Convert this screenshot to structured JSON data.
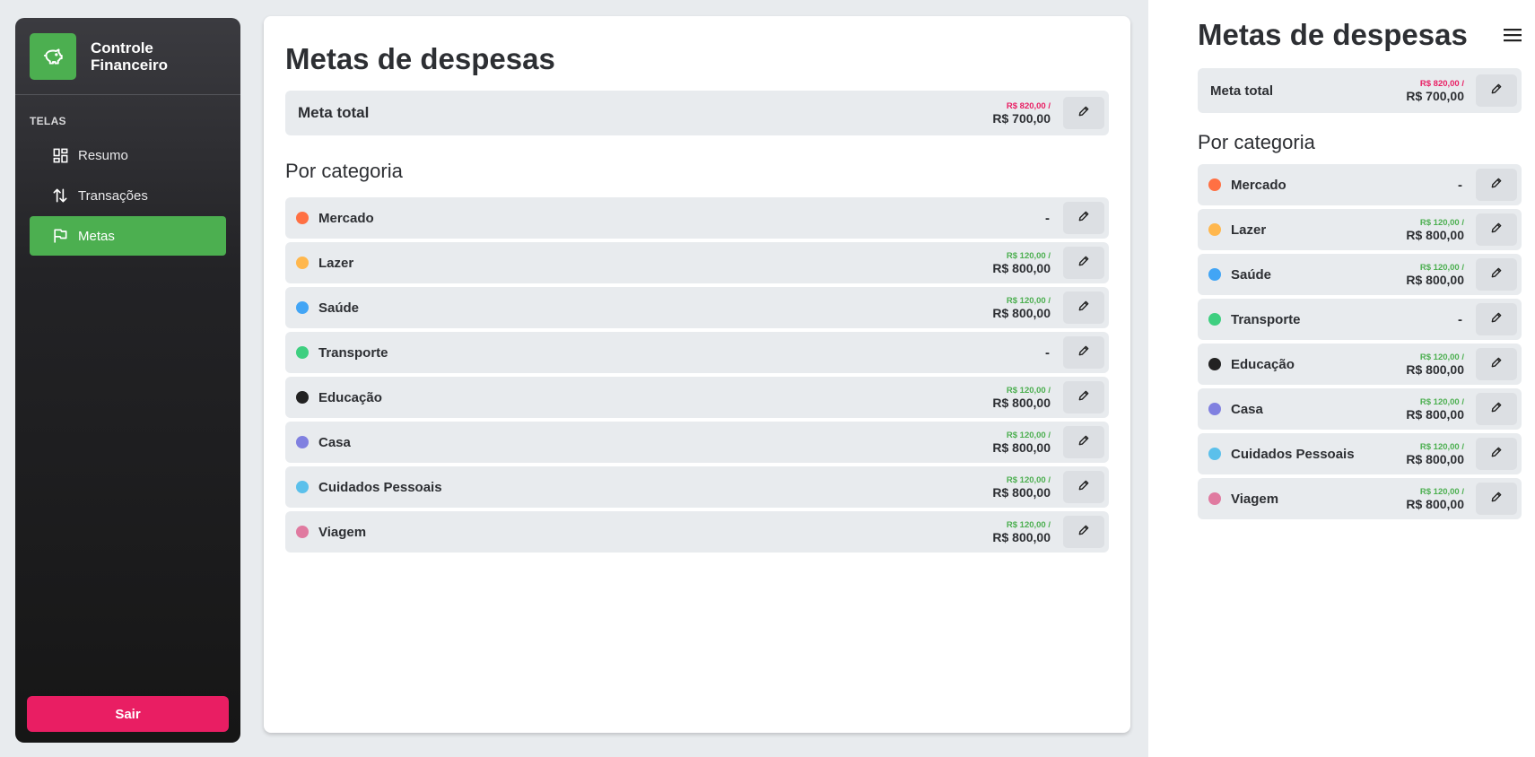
{
  "app": {
    "name": "Controle\nFinanceiro"
  },
  "sidebar": {
    "section_label": "TELAS",
    "items": [
      {
        "label": "Resumo",
        "icon": "dashboard-icon",
        "active": false
      },
      {
        "label": "Transações",
        "icon": "transfer-arrows-icon",
        "active": false
      },
      {
        "label": "Metas",
        "icon": "flag-icon",
        "active": true
      }
    ],
    "logout_label": "Sair"
  },
  "colors": {
    "accent": "#4caf50",
    "danger": "#e91e63",
    "spent_over": "#e91e63",
    "spent_ok": "#4caf50"
  },
  "page": {
    "title": "Metas de despesas",
    "total": {
      "label": "Meta total",
      "spent": "R$ 820,00 /",
      "goal": "R$ 700,00",
      "over": true
    },
    "categories_title": "Por categoria",
    "categories": [
      {
        "name": "Mercado",
        "color": "#ff7043",
        "spent": "",
        "goal": "-"
      },
      {
        "name": "Lazer",
        "color": "#ffb74d",
        "spent": "R$ 120,00 /",
        "goal": "R$ 800,00"
      },
      {
        "name": "Saúde",
        "color": "#42a5f5",
        "spent": "R$ 120,00 /",
        "goal": "R$ 800,00"
      },
      {
        "name": "Transporte",
        "color": "#3ecf80",
        "spent": "",
        "goal": "-"
      },
      {
        "name": "Educação",
        "color": "#222222",
        "spent": "R$ 120,00 /",
        "goal": "R$ 800,00"
      },
      {
        "name": "Casa",
        "color": "#8080e0",
        "spent": "R$ 120,00 /",
        "goal": "R$ 800,00"
      },
      {
        "name": "Cuidados Pessoais",
        "color": "#5bc0eb",
        "spent": "R$ 120,00 /",
        "goal": "R$ 800,00"
      },
      {
        "name": "Viagem",
        "color": "#e07aa0",
        "spent": "R$ 120,00 /",
        "goal": "R$ 800,00"
      }
    ]
  },
  "mobile": {
    "menu_icon": "hamburger-menu-icon"
  }
}
